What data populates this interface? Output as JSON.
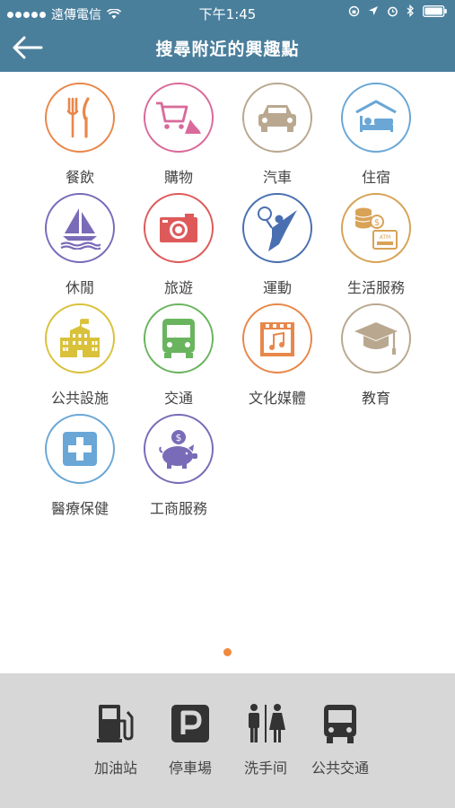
{
  "status": {
    "carrier": "遠傳電信",
    "time": "下午1:45"
  },
  "header": {
    "title": "搜尋附近的興趣點"
  },
  "categories": [
    {
      "label": "餐飲",
      "icon": "utensils-icon",
      "color": "#e8874a"
    },
    {
      "label": "購物",
      "icon": "shopping-cart-icon",
      "color": "#d96a9a"
    },
    {
      "label": "汽車",
      "icon": "car-icon",
      "color": "#b9a88f"
    },
    {
      "label": "住宿",
      "icon": "bed-icon",
      "color": "#6aa7d6"
    },
    {
      "label": "休閒",
      "icon": "sailboat-icon",
      "color": "#7a6bb8"
    },
    {
      "label": "旅遊",
      "icon": "camera-icon",
      "color": "#de5a5a"
    },
    {
      "label": "運動",
      "icon": "tennis-player-icon",
      "color": "#4a6fb0"
    },
    {
      "label": "生活服務",
      "icon": "atm-coins-icon",
      "color": "#d8a257"
    },
    {
      "label": "公共設施",
      "icon": "building-icon",
      "color": "#d9c13a"
    },
    {
      "label": "交通",
      "icon": "bus-icon",
      "color": "#6ab45f"
    },
    {
      "label": "文化媒體",
      "icon": "music-calendar-icon",
      "color": "#e8874a"
    },
    {
      "label": "教育",
      "icon": "graduation-cap-icon",
      "color": "#b9a88f"
    },
    {
      "label": "醫療保健",
      "icon": "medical-cross-icon",
      "color": "#6aa7d6"
    },
    {
      "label": "工商服務",
      "icon": "piggy-bank-icon",
      "color": "#7a6bb8"
    }
  ],
  "pager": {
    "pages": 1,
    "current": 1
  },
  "quick_links": [
    {
      "label": "加油站",
      "icon": "gas-station-icon"
    },
    {
      "label": "停車場",
      "icon": "parking-icon"
    },
    {
      "label": "洗手间",
      "icon": "restroom-icon"
    },
    {
      "label": "公共交通",
      "icon": "public-transport-icon"
    }
  ]
}
